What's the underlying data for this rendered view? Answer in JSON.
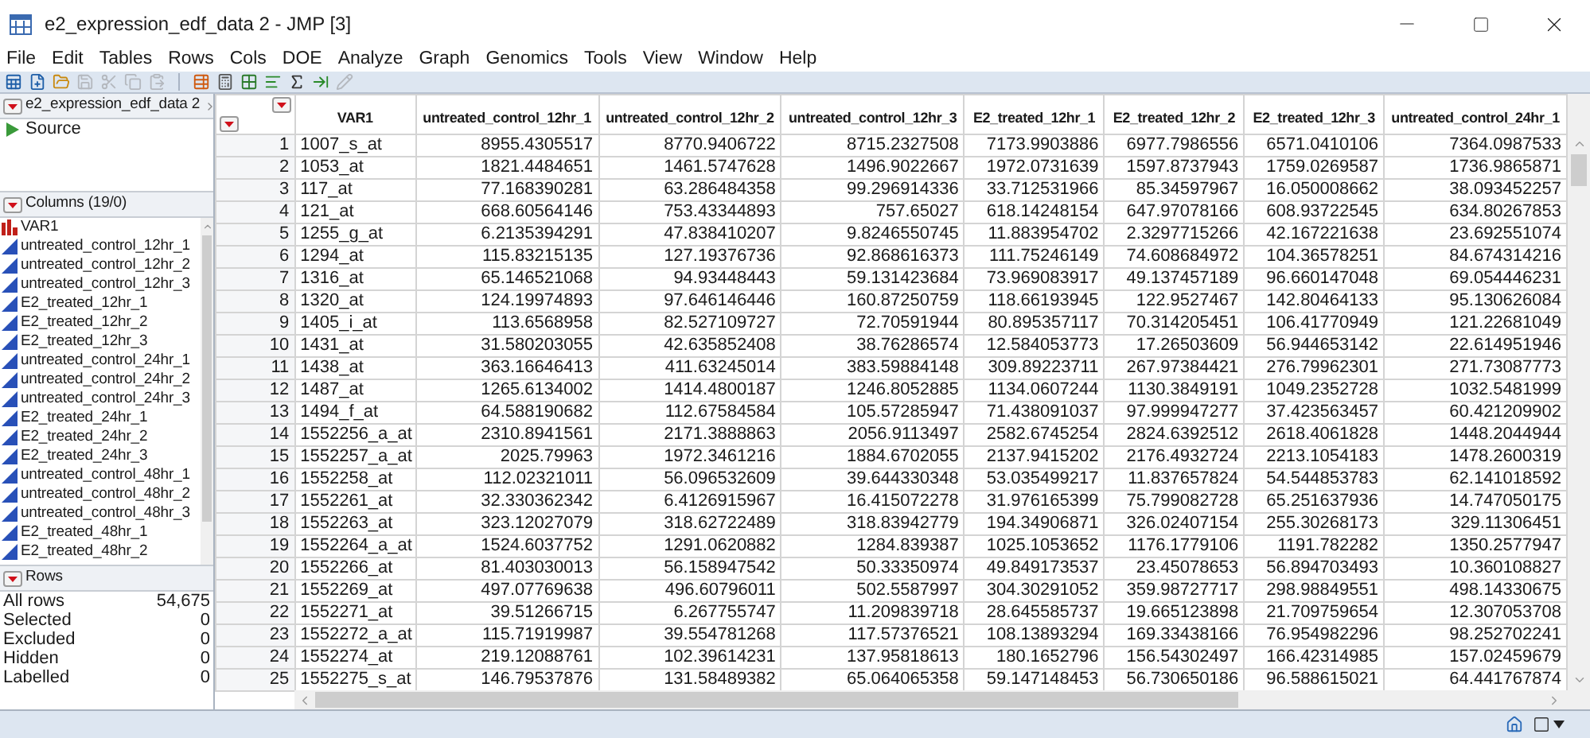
{
  "window": {
    "title": "e2_expression_edf_data 2 - JMP [3]"
  },
  "menu": [
    "File",
    "Edit",
    "Tables",
    "Rows",
    "Cols",
    "DOE",
    "Analyze",
    "Graph",
    "Genomics",
    "Tools",
    "View",
    "Window",
    "Help"
  ],
  "toolbar": [
    {
      "disabled": false
    },
    {
      "disabled": false
    },
    {
      "disabled": false
    },
    {
      "disabled": true
    },
    {
      "disabled": true
    },
    {
      "disabled": true
    },
    {
      "disabled": true
    },
    {
      "disabled": false
    },
    {
      "disabled": false
    },
    {
      "disabled": false
    },
    {
      "disabled": false
    },
    {
      "disabled": false
    },
    {
      "disabled": false
    },
    {
      "disabled": true
    }
  ],
  "table_panel": {
    "title": "e2_expression_edf_data 2",
    "scripts": [
      "Source"
    ]
  },
  "columns_panel": {
    "title": "Columns (19/0)",
    "items": [
      {
        "name": "VAR1",
        "kind": "nominal"
      },
      {
        "name": "untreated_control_12hr_1",
        "kind": "continuous"
      },
      {
        "name": "untreated_control_12hr_2",
        "kind": "continuous"
      },
      {
        "name": "untreated_control_12hr_3",
        "kind": "continuous"
      },
      {
        "name": "E2_treated_12hr_1",
        "kind": "continuous"
      },
      {
        "name": "E2_treated_12hr_2",
        "kind": "continuous"
      },
      {
        "name": "E2_treated_12hr_3",
        "kind": "continuous"
      },
      {
        "name": "untreated_control_24hr_1",
        "kind": "continuous"
      },
      {
        "name": "untreated_control_24hr_2",
        "kind": "continuous"
      },
      {
        "name": "untreated_control_24hr_3",
        "kind": "continuous"
      },
      {
        "name": "E2_treated_24hr_1",
        "kind": "continuous"
      },
      {
        "name": "E2_treated_24hr_2",
        "kind": "continuous"
      },
      {
        "name": "E2_treated_24hr_3",
        "kind": "continuous"
      },
      {
        "name": "untreated_control_48hr_1",
        "kind": "continuous"
      },
      {
        "name": "untreated_control_48hr_2",
        "kind": "continuous"
      },
      {
        "name": "untreated_control_48hr_3",
        "kind": "continuous"
      },
      {
        "name": "E2_treated_48hr_1",
        "kind": "continuous"
      },
      {
        "name": "E2_treated_48hr_2",
        "kind": "continuous"
      }
    ]
  },
  "rows_panel": {
    "title": "Rows",
    "items": [
      {
        "label": "All rows",
        "value": "54,675"
      },
      {
        "label": "Selected",
        "value": "0"
      },
      {
        "label": "Excluded",
        "value": "0"
      },
      {
        "label": "Hidden",
        "value": "0"
      },
      {
        "label": "Labelled",
        "value": "0"
      }
    ]
  },
  "table": {
    "columns": [
      "VAR1",
      "untreated_control_12hr_1",
      "untreated_control_12hr_2",
      "untreated_control_12hr_3",
      "E2_treated_12hr_1",
      "E2_treated_12hr_2",
      "E2_treated_12hr_3",
      "untreated_control_24hr_1"
    ],
    "rows": [
      {
        "number": "1",
        "cells": [
          "1007_s_at",
          "8955.4305517",
          "8770.9406722",
          "8715.2327508",
          "7173.9903886",
          "6977.7986556",
          "6571.0410106",
          "7364.0987533"
        ]
      },
      {
        "number": "2",
        "cells": [
          "1053_at",
          "1821.4484651",
          "1461.5747628",
          "1496.9022667",
          "1972.0731639",
          "1597.8737943",
          "1759.0269587",
          "1736.9865871"
        ]
      },
      {
        "number": "3",
        "cells": [
          "117_at",
          "77.168390281",
          "63.286484358",
          "99.296914336",
          "33.712531966",
          "85.34597967",
          "16.050008662",
          "38.093452257"
        ]
      },
      {
        "number": "4",
        "cells": [
          "121_at",
          "668.60564146",
          "753.43344893",
          "757.65027",
          "618.14248154",
          "647.97078166",
          "608.93722545",
          "634.80267853"
        ]
      },
      {
        "number": "5",
        "cells": [
          "1255_g_at",
          "6.2135394291",
          "47.838410207",
          "9.8246550745",
          "11.883954702",
          "2.3297715266",
          "42.167221638",
          "23.692551074"
        ]
      },
      {
        "number": "6",
        "cells": [
          "1294_at",
          "115.83215135",
          "127.19376736",
          "92.868616373",
          "111.75246149",
          "74.608684972",
          "104.36578251",
          "84.674314216"
        ]
      },
      {
        "number": "7",
        "cells": [
          "1316_at",
          "65.146521068",
          "94.93448443",
          "59.131423684",
          "73.969083917",
          "49.137457189",
          "96.660147048",
          "69.054446231"
        ]
      },
      {
        "number": "8",
        "cells": [
          "1320_at",
          "124.19974893",
          "97.646146446",
          "160.87250759",
          "118.66193945",
          "122.9527467",
          "142.80464133",
          "95.130626084"
        ]
      },
      {
        "number": "9",
        "cells": [
          "1405_i_at",
          "113.6568958",
          "82.527109727",
          "72.70591944",
          "80.895357117",
          "70.314205451",
          "106.41770949",
          "121.22681049"
        ]
      },
      {
        "number": "10",
        "cells": [
          "1431_at",
          "31.580203055",
          "42.635852408",
          "38.76286574",
          "12.584053773",
          "17.26503609",
          "56.944653142",
          "22.614951946"
        ]
      },
      {
        "number": "11",
        "cells": [
          "1438_at",
          "363.16646413",
          "411.63245014",
          "383.59884148",
          "309.89223711",
          "267.97384421",
          "276.79962301",
          "271.73087773"
        ]
      },
      {
        "number": "12",
        "cells": [
          "1487_at",
          "1265.6134002",
          "1414.4800187",
          "1246.8052885",
          "1134.0607244",
          "1130.3849191",
          "1049.2352728",
          "1032.5481999"
        ]
      },
      {
        "number": "13",
        "cells": [
          "1494_f_at",
          "64.588190682",
          "112.67584584",
          "105.57285947",
          "71.438091037",
          "97.999947277",
          "37.423563457",
          "60.421209902"
        ]
      },
      {
        "number": "14",
        "cells": [
          "1552256_a_at",
          "2310.8941561",
          "2171.3888863",
          "2056.9113497",
          "2582.6745254",
          "2824.6392512",
          "2618.4061828",
          "1448.2044944"
        ]
      },
      {
        "number": "15",
        "cells": [
          "1552257_a_at",
          "2025.79963",
          "1972.3461216",
          "1884.6702055",
          "2137.9415202",
          "2176.4932724",
          "2213.1054183",
          "1478.2600319"
        ]
      },
      {
        "number": "16",
        "cells": [
          "1552258_at",
          "112.02321011",
          "56.096532609",
          "39.644330348",
          "53.035499217",
          "11.837657824",
          "54.544853783",
          "62.141018592"
        ]
      },
      {
        "number": "17",
        "cells": [
          "1552261_at",
          "32.330362342",
          "6.4126915967",
          "16.415072278",
          "31.976165399",
          "75.799082728",
          "65.251637936",
          "14.747050175"
        ]
      },
      {
        "number": "18",
        "cells": [
          "1552263_at",
          "323.12027079",
          "318.62722489",
          "318.83942779",
          "194.34906871",
          "326.02407154",
          "255.30268173",
          "329.11306451"
        ]
      },
      {
        "number": "19",
        "cells": [
          "1552264_a_at",
          "1524.6037752",
          "1291.0620882",
          "1284.839387",
          "1025.1053652",
          "1176.1779106",
          "1191.782282",
          "1350.2577947"
        ]
      },
      {
        "number": "20",
        "cells": [
          "1552266_at",
          "81.403030013",
          "56.158947542",
          "50.33350974",
          "49.849173537",
          "23.45078653",
          "56.894703493",
          "10.360108827"
        ]
      },
      {
        "number": "21",
        "cells": [
          "1552269_at",
          "497.07769638",
          "496.60796011",
          "502.5587997",
          "304.30291052",
          "359.98727717",
          "298.98849551",
          "498.14330675"
        ]
      },
      {
        "number": "22",
        "cells": [
          "1552271_at",
          "39.51266715",
          "6.267755747",
          "11.209839718",
          "28.645585737",
          "19.665123898",
          "21.709759654",
          "12.307053708"
        ]
      },
      {
        "number": "23",
        "cells": [
          "1552272_a_at",
          "115.71919987",
          "39.554781268",
          "117.57376521",
          "108.13893294",
          "169.33438166",
          "76.954982296",
          "98.252702241"
        ]
      },
      {
        "number": "24",
        "cells": [
          "1552274_at",
          "219.12088761",
          "102.39614231",
          "137.95818613",
          "180.1652796",
          "156.54302497",
          "166.42314985",
          "157.02459679"
        ]
      },
      {
        "number": "25",
        "cells": [
          "1552275_s_at",
          "146.79537876",
          "131.58489382",
          "65.064065358",
          "59.147148453",
          "56.730650186",
          "96.588615021",
          "64.441767874"
        ]
      }
    ]
  }
}
